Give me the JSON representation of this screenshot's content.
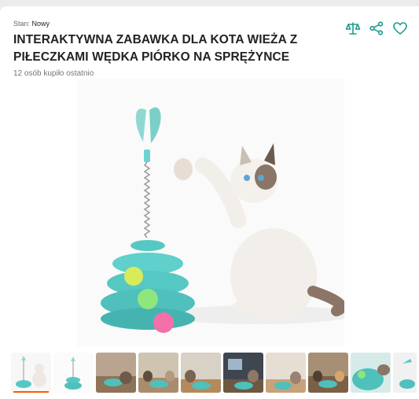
{
  "product": {
    "condition_label": "Stan:",
    "condition_value": "Nowy",
    "title": "INTERAKTYWNA ZABAWKA DLA KOTA WIEŻA Z PIŁECZKAMI WĘDKA PIÓRKO NA SPRĘŻYNCE",
    "sold_info": "12 osób kupiło ostatnio"
  },
  "actions": {
    "icons": [
      "compare-scale-icon",
      "share-icon",
      "heart-icon"
    ],
    "accent_color": "#1a9c8f"
  },
  "gallery": {
    "thumbnail_count": 10,
    "active_index": 0,
    "active_indicator_color": "#ff5a00"
  }
}
